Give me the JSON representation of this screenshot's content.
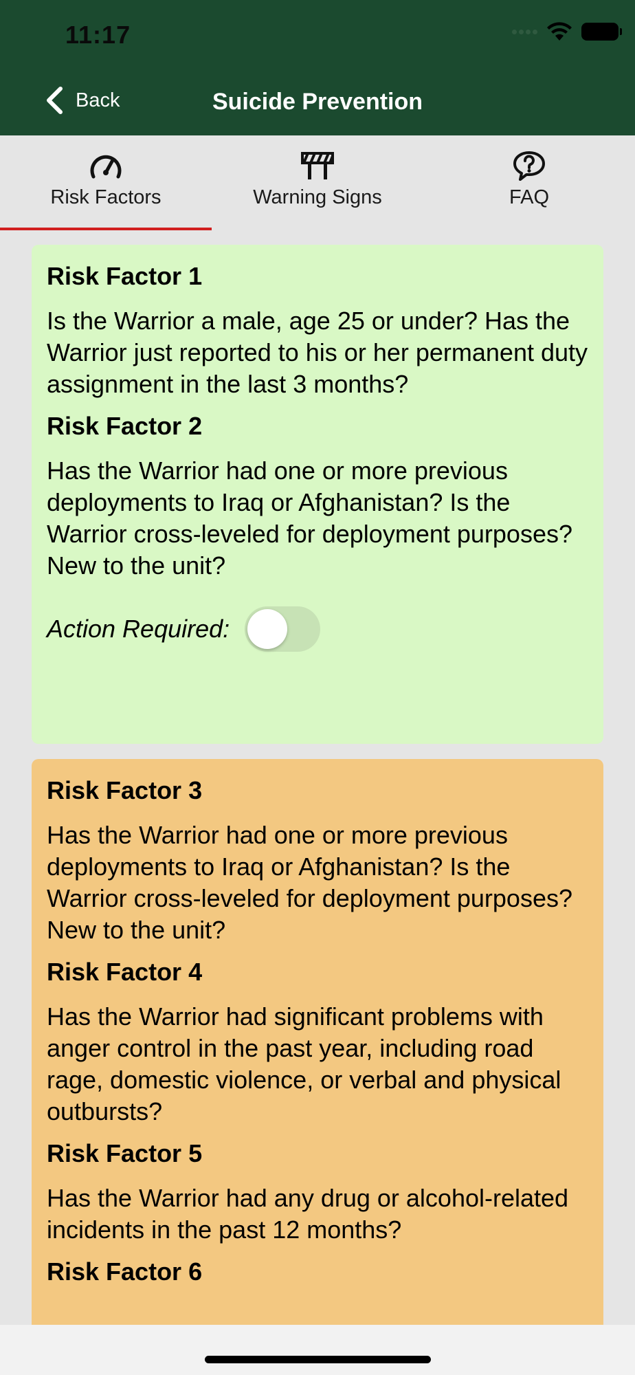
{
  "status_bar": {
    "time": "11:17"
  },
  "nav": {
    "back_label": "Back",
    "title": "Suicide Prevention",
    "bar_color": "#1b4a2f"
  },
  "tabs": [
    {
      "label": "Risk Factors",
      "icon": "speedometer-icon",
      "active": true
    },
    {
      "label": "Warning Signs",
      "icon": "barrier-icon",
      "active": false
    },
    {
      "label": "FAQ",
      "icon": "question-bubble-icon",
      "active": false
    }
  ],
  "cards": [
    {
      "color": "#d9f8c5",
      "items": [
        {
          "heading": "Risk Factor 1",
          "text": "Is the Warrior a male, age 25 or under? Has the Warrior just reported to his or her permanent duty assignment in the last 3 months?"
        },
        {
          "heading": "Risk Factor 2",
          "text": "Has the Warrior had one or more previous deployments to Iraq or Afghanistan? Is the Warrior cross-leveled for deployment purposes? New to the unit?"
        }
      ],
      "action_label": "Action Required:",
      "action_required": false
    },
    {
      "color": "#f3c881",
      "items": [
        {
          "heading": "Risk Factor 3",
          "text": "Has the Warrior had one or more previous deployments to Iraq or Afghanistan? Is the Warrior cross-leveled for deployment purposes? New to the unit?"
        },
        {
          "heading": "Risk Factor 4",
          "text": "Has the Warrior had significant problems with anger control in the past year, including road rage, domestic violence, or verbal and physical outbursts?"
        },
        {
          "heading": "Risk Factor 5",
          "text": "Has the Warrior had any drug or alcohol-related incidents in the past 12 months?"
        },
        {
          "heading": "Risk Factor 6"
        }
      ]
    }
  ],
  "accent_color": "#d11f1f"
}
